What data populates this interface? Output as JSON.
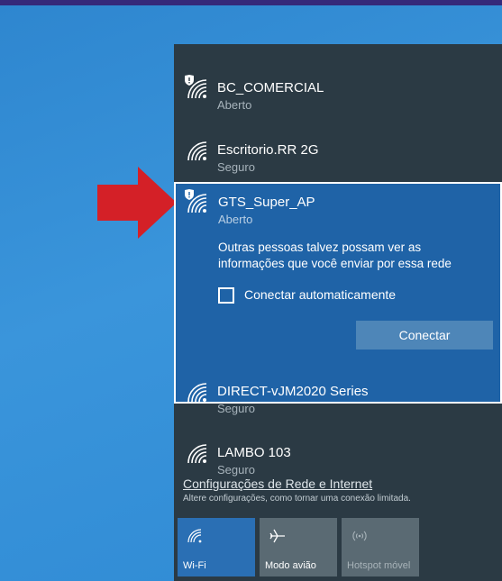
{
  "networks": [
    {
      "ssid": "BC_COMERCIAL",
      "status": "Aberto",
      "secured": false
    },
    {
      "ssid": "Escritorio.RR 2G",
      "status": "Seguro",
      "secured": true
    }
  ],
  "selected_network": {
    "ssid": "GTS_Super_AP",
    "status": "Aberto",
    "warning": "Outras pessoas talvez possam ver as informações que você enviar por essa rede",
    "auto_connect_label": "Conectar automaticamente",
    "auto_connect_checked": false,
    "connect_button": "Conectar"
  },
  "more_networks": [
    {
      "ssid": "DIRECT-vJM2020 Series",
      "status": "Seguro"
    },
    {
      "ssid": "LAMBO 103",
      "status": "Seguro"
    }
  ],
  "settings": {
    "link": "Configurações de Rede e Internet",
    "subtitle": "Altere configurações, como tornar uma conexão limitada."
  },
  "quick_actions": {
    "wifi": "Wi-Fi",
    "airplane": "Modo avião",
    "hotspot": "Hotspot móvel"
  },
  "colors": {
    "accent": "#1f63a7",
    "flyout_bg": "#2b3a44",
    "arrow": "#d42027"
  }
}
